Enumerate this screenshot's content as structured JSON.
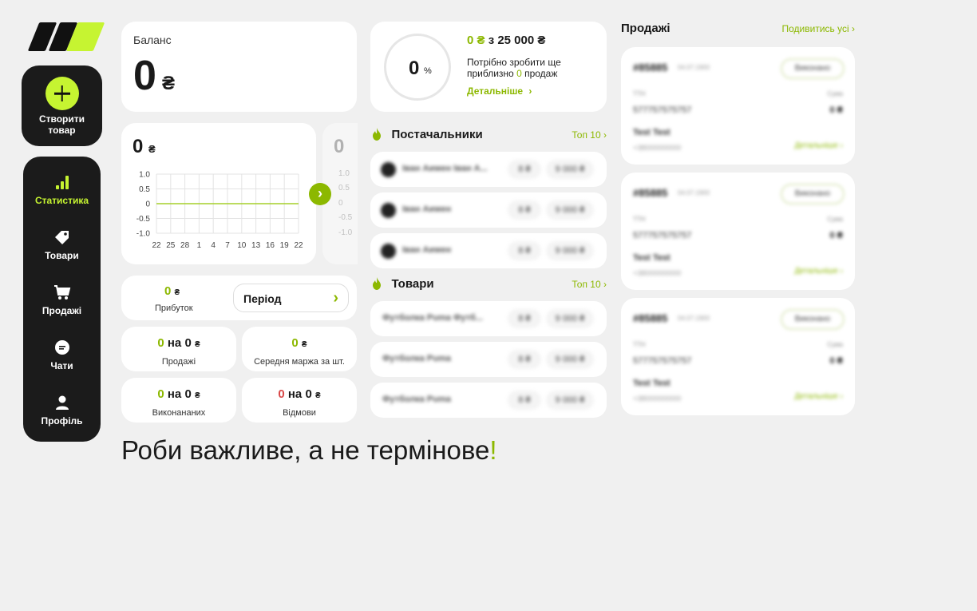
{
  "sidebar": {
    "create_label_1": "Створити",
    "create_label_2": "товар",
    "items": [
      {
        "label": "Статистика",
        "active": true
      },
      {
        "label": "Товари",
        "active": false
      },
      {
        "label": "Продажі",
        "active": false
      },
      {
        "label": "Чати",
        "active": false
      },
      {
        "label": "Профіль",
        "active": false
      }
    ]
  },
  "balance": {
    "title": "Баланс",
    "value": "0",
    "currency": "₴"
  },
  "chart": {
    "value": "0",
    "currency": "₴",
    "ghost_value": "0"
  },
  "chart_data": {
    "type": "line",
    "categories": [
      "22",
      "25",
      "28",
      "1",
      "4",
      "7",
      "10",
      "13",
      "16",
      "19",
      "22"
    ],
    "series": [
      {
        "values": [
          0,
          0,
          0,
          0,
          0,
          0,
          0,
          0,
          0,
          0,
          0
        ]
      }
    ],
    "yticks": [
      "1.0",
      "0.5",
      "0",
      "-0.5",
      "-1.0"
    ],
    "ylim": [
      -1,
      1
    ],
    "grid": true
  },
  "profit": {
    "value": "0",
    "currency": "₴",
    "label": "Прибуток",
    "period_label": "Період"
  },
  "stats": [
    {
      "a": "0",
      "mid": "на",
      "b": "0",
      "currency": "₴",
      "label": "Продажі",
      "a_color": "green"
    },
    {
      "a": "0",
      "currency": "₴",
      "label": "Середня маржа за шт.",
      "a_color": "green"
    },
    {
      "a": "0",
      "mid": "на",
      "b": "0",
      "currency": "₴",
      "label": "Виконананих",
      "a_color": "green"
    },
    {
      "a": "0",
      "mid": "на",
      "b": "0",
      "currency": "₴",
      "label": "Відмови",
      "a_color": "red"
    }
  ],
  "progress": {
    "percent": "0",
    "percent_sign": "%",
    "current": "0 ₴",
    "of": "з",
    "target": "25 000 ₴",
    "desc_1": "Потрібно зробити ще",
    "desc_2a": "приблизно",
    "desc_2b": "0",
    "desc_2c": "продаж",
    "more": "Детальніше"
  },
  "suppliers": {
    "title": "Постачальники",
    "top": "Топ 10",
    "rows": [
      {
        "name": "Іван Аимен Іван А...",
        "p1": "8 ₴",
        "p2": "9 000 ₴"
      },
      {
        "name": "Іван Аимен",
        "p1": "8 ₴",
        "p2": "9 000 ₴"
      },
      {
        "name": "Іван Аимен",
        "p1": "8 ₴",
        "p2": "9 000 ₴"
      }
    ]
  },
  "products": {
    "title": "Товари",
    "top": "Топ 10",
    "rows": [
      {
        "name": "Футболка Puma Футб...",
        "p1": "8 ₴",
        "p2": "9 000 ₴"
      },
      {
        "name": "Футболка Puma",
        "p1": "8 ₴",
        "p2": "9 000 ₴"
      },
      {
        "name": "Футболка Puma",
        "p1": "8 ₴",
        "p2": "9 000 ₴"
      }
    ]
  },
  "sales": {
    "title": "Продажі",
    "see_all": "Подивитись усі",
    "orders": [
      {
        "num": "#85885",
        "date": "04.07.1900",
        "status": "Виконано",
        "ttn_label": "ТТН",
        "sum_label": "Сума",
        "ttn": "577757575757",
        "sum": "0 ₴",
        "name": "Test Test",
        "phone": "+38000000000",
        "details": "Детальніше"
      },
      {
        "num": "#85885",
        "date": "04.07.1900",
        "status": "Виконано",
        "ttn_label": "ТТН",
        "sum_label": "Сума",
        "ttn": "577757575757",
        "sum": "0 ₴",
        "name": "Test Test",
        "phone": "+38000000000",
        "details": "Детальніше"
      },
      {
        "num": "#85885",
        "date": "04.07.1900",
        "status": "Виконано",
        "ttn_label": "ТТН",
        "sum_label": "Сума",
        "ttn": "577757575757",
        "sum": "0 ₴",
        "name": "Test Test",
        "phone": "+38000000000",
        "details": "Детальніше"
      }
    ]
  },
  "slogan": {
    "text": "Роби важливе, а не термінове",
    "mark": "!"
  }
}
